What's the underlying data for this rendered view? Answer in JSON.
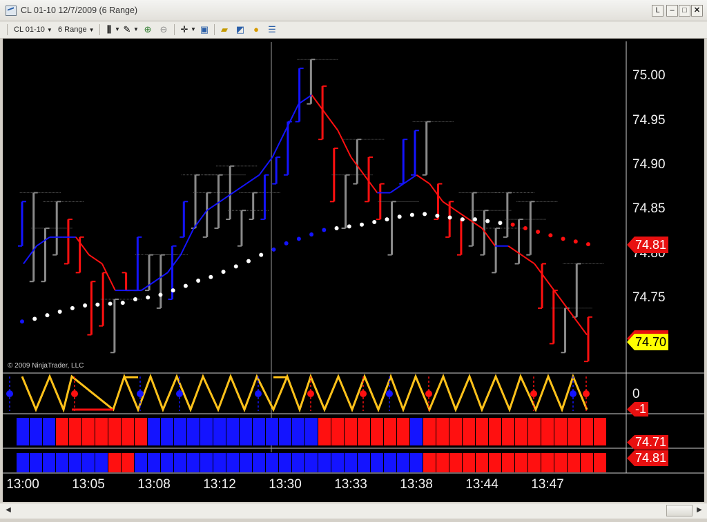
{
  "window": {
    "title": "CL 01-10  12/7/2009 (6 Range)",
    "buttons": {
      "restore": "L",
      "minimize": "–",
      "maximize": "□",
      "close": "✕"
    }
  },
  "toolbar": {
    "instrument": "CL 01-10",
    "period": "6 Range",
    "icons": [
      "bar-style-icon",
      "drawing-pencil-icon",
      "zoom-in-icon",
      "zoom-out-icon",
      "crosshair-icon",
      "data-box-icon",
      "properties-folder-icon",
      "indicators-icon",
      "strategies-icon",
      "chart-trader-icon"
    ]
  },
  "chart": {
    "copyright": "© 2009 NinjaTrader, LLC",
    "price_axis_labels": [
      "75.00",
      "74.95",
      "74.90",
      "74.85",
      "74.80",
      "74.75"
    ],
    "time_axis_labels": [
      "13:00",
      "13:05",
      "13:08",
      "13:12",
      "13:30",
      "13:33",
      "13:38",
      "13:44",
      "13:47"
    ],
    "price_tags": {
      "hidden": "74.71",
      "current": "74.70",
      "upper_indicator": "74.81"
    },
    "oscillator_zero_label": "0",
    "oscillator_tag": "-1",
    "panel3_tag": "74.71",
    "panel4_tag": "74.81",
    "colors": {
      "background": "#000000",
      "up": "#1414ff",
      "down": "#ff1010",
      "neutral": "#8a8a8a",
      "zigzag": "#ffc21a",
      "current_tag": "#ffff00"
    }
  },
  "chart_data": {
    "type": "line",
    "instrument": "CL 01-10",
    "date": "12/7/2009",
    "bar_type": "6 Range",
    "ylim": [
      74.68,
      75.04
    ],
    "time_labels": [
      "13:00",
      "13:05",
      "13:08",
      "13:12",
      "13:30",
      "13:33",
      "13:38",
      "13:44",
      "13:47"
    ],
    "bars": [
      [
        74.86,
        74.81,
        "up"
      ],
      [
        74.87,
        74.77,
        "neutral"
      ],
      [
        74.83,
        74.77,
        "neutral"
      ],
      [
        74.86,
        74.8,
        "neutral"
      ],
      [
        74.84,
        74.79,
        "down"
      ],
      [
        74.82,
        74.78,
        "down"
      ],
      [
        74.77,
        74.71,
        "down"
      ],
      [
        74.78,
        74.72,
        "down"
      ],
      [
        74.75,
        74.69,
        "neutral"
      ],
      [
        74.76,
        74.78,
        "down"
      ],
      [
        74.82,
        74.76,
        "up"
      ],
      [
        74.8,
        74.76,
        "neutral"
      ],
      [
        74.8,
        74.74,
        "neutral"
      ],
      [
        74.81,
        74.75,
        "up"
      ],
      [
        74.86,
        74.82,
        "up"
      ],
      [
        74.89,
        74.83,
        "neutral"
      ],
      [
        74.87,
        74.82,
        "neutral"
      ],
      [
        74.89,
        74.83,
        "neutral"
      ],
      [
        74.9,
        74.84,
        "neutral"
      ],
      [
        74.85,
        74.81,
        "neutral"
      ],
      [
        74.87,
        74.84,
        "neutral"
      ],
      [
        74.89,
        74.84,
        "up"
      ],
      [
        74.91,
        74.88,
        "up"
      ],
      [
        74.95,
        74.89,
        "up"
      ],
      [
        75.01,
        74.95,
        "up"
      ],
      [
        75.02,
        74.97,
        "neutral"
      ],
      [
        74.99,
        74.93,
        "down"
      ],
      [
        74.92,
        74.86,
        "down"
      ],
      [
        74.89,
        74.83,
        "neutral"
      ],
      [
        74.93,
        74.88,
        "neutral"
      ],
      [
        74.91,
        74.86,
        "down"
      ],
      [
        74.88,
        74.84,
        "down"
      ],
      [
        74.86,
        74.8,
        "neutral"
      ],
      [
        74.93,
        74.88,
        "up"
      ],
      [
        74.94,
        74.89,
        "up"
      ],
      [
        74.95,
        74.89,
        "neutral"
      ],
      [
        74.88,
        74.84,
        "down"
      ],
      [
        74.86,
        74.82,
        "down"
      ],
      [
        74.84,
        74.8,
        "down"
      ],
      [
        74.87,
        74.81,
        "neutral"
      ],
      [
        74.85,
        74.8,
        "neutral"
      ],
      [
        74.83,
        74.78,
        "neutral"
      ],
      [
        74.87,
        74.82,
        "neutral"
      ],
      [
        74.84,
        74.79,
        "neutral"
      ],
      [
        74.86,
        74.8,
        "neutral"
      ],
      [
        74.79,
        74.74,
        "down"
      ],
      [
        74.76,
        74.7,
        "down"
      ],
      [
        74.74,
        74.69,
        "neutral"
      ],
      [
        74.79,
        74.73,
        "neutral"
      ],
      [
        74.73,
        74.68,
        "down"
      ]
    ],
    "moving_average": [
      74.79,
      74.81,
      74.82,
      74.82,
      74.82,
      74.8,
      74.79,
      74.76,
      74.76,
      74.76,
      74.77,
      74.78,
      74.8,
      74.83,
      74.85,
      74.86,
      74.87,
      74.88,
      74.89,
      74.91,
      74.94,
      74.97,
      74.98,
      74.96,
      74.94,
      74.91,
      74.89,
      74.87,
      74.87,
      74.88,
      74.89,
      74.88,
      74.86,
      74.85,
      74.84,
      74.83,
      74.81,
      74.81,
      74.8,
      74.79,
      74.77,
      74.75,
      74.73,
      74.71
    ],
    "trailing_stop_dots": [
      74.725,
      74.728,
      74.732,
      74.736,
      74.74,
      74.743,
      74.744,
      74.745,
      74.746,
      74.75,
      74.752,
      74.755,
      74.76,
      74.765,
      74.771,
      74.775,
      74.781,
      74.787,
      74.793,
      74.8,
      74.806,
      74.813,
      74.818,
      74.823,
      74.828,
      74.83,
      74.832,
      74.834,
      74.837,
      74.84,
      74.843,
      74.845,
      74.846,
      74.844,
      74.842,
      74.84,
      74.84,
      74.838,
      74.836,
      74.834,
      74.83,
      74.826,
      74.822,
      74.818,
      74.815,
      74.812
    ],
    "oscillator_zero": 0,
    "oscillator_last": -1,
    "panel3_last": 74.71,
    "panel4_last": 74.81,
    "panel3_blocks": [
      "b",
      "b",
      "b",
      "r",
      "r",
      "r",
      "r",
      "r",
      "r",
      "r",
      "b",
      "b",
      "b",
      "b",
      "b",
      "b",
      "b",
      "b",
      "b",
      "b",
      "b",
      "b",
      "b",
      "r",
      "r",
      "r",
      "r",
      "r",
      "r",
      "r",
      "b",
      "r",
      "r",
      "r",
      "r",
      "r",
      "r",
      "r",
      "r",
      "r",
      "r",
      "r",
      "r",
      "r",
      "r"
    ],
    "panel4_blocks": [
      "b",
      "b",
      "b",
      "b",
      "b",
      "b",
      "b",
      "r",
      "r",
      "b",
      "b",
      "b",
      "b",
      "b",
      "b",
      "b",
      "b",
      "b",
      "b",
      "b",
      "b",
      "b",
      "b",
      "b",
      "b",
      "b",
      "b",
      "b",
      "b",
      "b",
      "b",
      "r",
      "r",
      "r",
      "r",
      "r",
      "r",
      "r",
      "r",
      "r",
      "r",
      "r",
      "r",
      "r",
      "r"
    ]
  }
}
